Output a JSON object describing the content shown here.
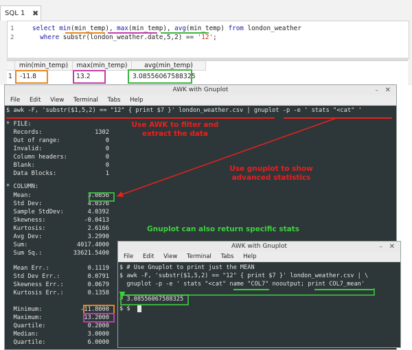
{
  "sql_tab": {
    "label": "SQL 1",
    "close_glyph": "✖"
  },
  "sql_editor": {
    "line_numbers": [
      "1",
      "2"
    ],
    "line1": {
      "k1": "select ",
      "f1": "min",
      "a1": "(min_temp), ",
      "f2": "max",
      "a2": "(min_temp), ",
      "f3": "avg",
      "a3": "(min_temp) ",
      "k2": "from",
      "a4": " london_weather"
    },
    "line2": {
      "k1": "  where ",
      "a1": "substr(london_weather.date,5,2) == ",
      "s1": "'12'",
      "a2": ";"
    }
  },
  "results": {
    "columns": [
      "min(min_temp)",
      "max(min_temp)",
      "avg(min_temp)"
    ],
    "row_number": "1",
    "row": [
      "-11.8",
      "13.2",
      "3.08556067588325"
    ]
  },
  "term_main": {
    "title": "AWK with Gnuplot",
    "menu": [
      "File",
      "Edit",
      "View",
      "Terminal",
      "Tabs",
      "Help"
    ],
    "command": "$ awk -F, 'substr($1,5,2) == \"12\" { print $7 }' london_weather.csv | gnuplot -p -e ' stats \"<cat\" '",
    "file_header": "* FILE:",
    "file_stats": [
      {
        "label": "  Records:",
        "value": "1302"
      },
      {
        "label": "  Out of range:",
        "value": "0"
      },
      {
        "label": "  Invalid:",
        "value": "0"
      },
      {
        "label": "  Column headers:",
        "value": "0"
      },
      {
        "label": "  Blank:",
        "value": "0"
      },
      {
        "label": "  Data Blocks:",
        "value": "1"
      }
    ],
    "column_header": "* COLUMN:",
    "column_stats": [
      {
        "label": "  Mean:",
        "value": "3.0856"
      },
      {
        "label": "  Std Dev:",
        "value": "4.0376"
      },
      {
        "label": "  Sample StdDev:",
        "value": "4.0392"
      },
      {
        "label": "  Skewness:",
        "value": "-0.0413"
      },
      {
        "label": "  Kurtosis:",
        "value": "2.6166"
      },
      {
        "label": "  Avg Dev:",
        "value": "3.2990"
      },
      {
        "label": "  Sum:",
        "value": "4017.4000"
      },
      {
        "label": "  Sum Sq.:",
        "value": "33621.5400"
      }
    ],
    "error_stats": [
      {
        "label": "  Mean Err.:",
        "value": "0.1119"
      },
      {
        "label": "  Std Dev Err.:",
        "value": "0.0791"
      },
      {
        "label": "  Skewness Err.:",
        "value": "0.0679"
      },
      {
        "label": "  Kurtosis Err.:",
        "value": "0.1358"
      }
    ],
    "range_stats": [
      {
        "label": "  Minimum:",
        "value": "-11.8000"
      },
      {
        "label": "  Maximum:",
        "value": "13.2000"
      },
      {
        "label": "  Quartile:",
        "value": "0.2000"
      },
      {
        "label": "  Median:",
        "value": "3.0000"
      },
      {
        "label": "  Quartile:",
        "value": "6.0000"
      }
    ]
  },
  "term_small": {
    "title": "AWK with Gnuplot",
    "menu": [
      "File",
      "Edit",
      "View",
      "Terminal",
      "Tabs",
      "Help"
    ],
    "lines": [
      "$ # Use Gnuplot to print just the MEAN",
      "$ awk -F, 'substr($1,5,2) == \"12\" { print $7 }' london_weather.csv | \\",
      "  gnuplot -p -e ' stats \"<cat\" name \"COL7\" nooutput; print COL7_mean'",
      "> 3.08556067588325",
      "$ $ "
    ]
  },
  "annotations": {
    "awk_note": "Use AWK to filter and extract the data",
    "gnuplot_note": "Use gnuplot to show advanced statistics",
    "specific_note": "Gnuplot can also return specific stats"
  },
  "colors": {
    "orange": "#e8861a",
    "magenta": "#c23ca8",
    "green": "#3cb43c",
    "red": "#e8211f",
    "terminal_bg": "#2d3638"
  }
}
